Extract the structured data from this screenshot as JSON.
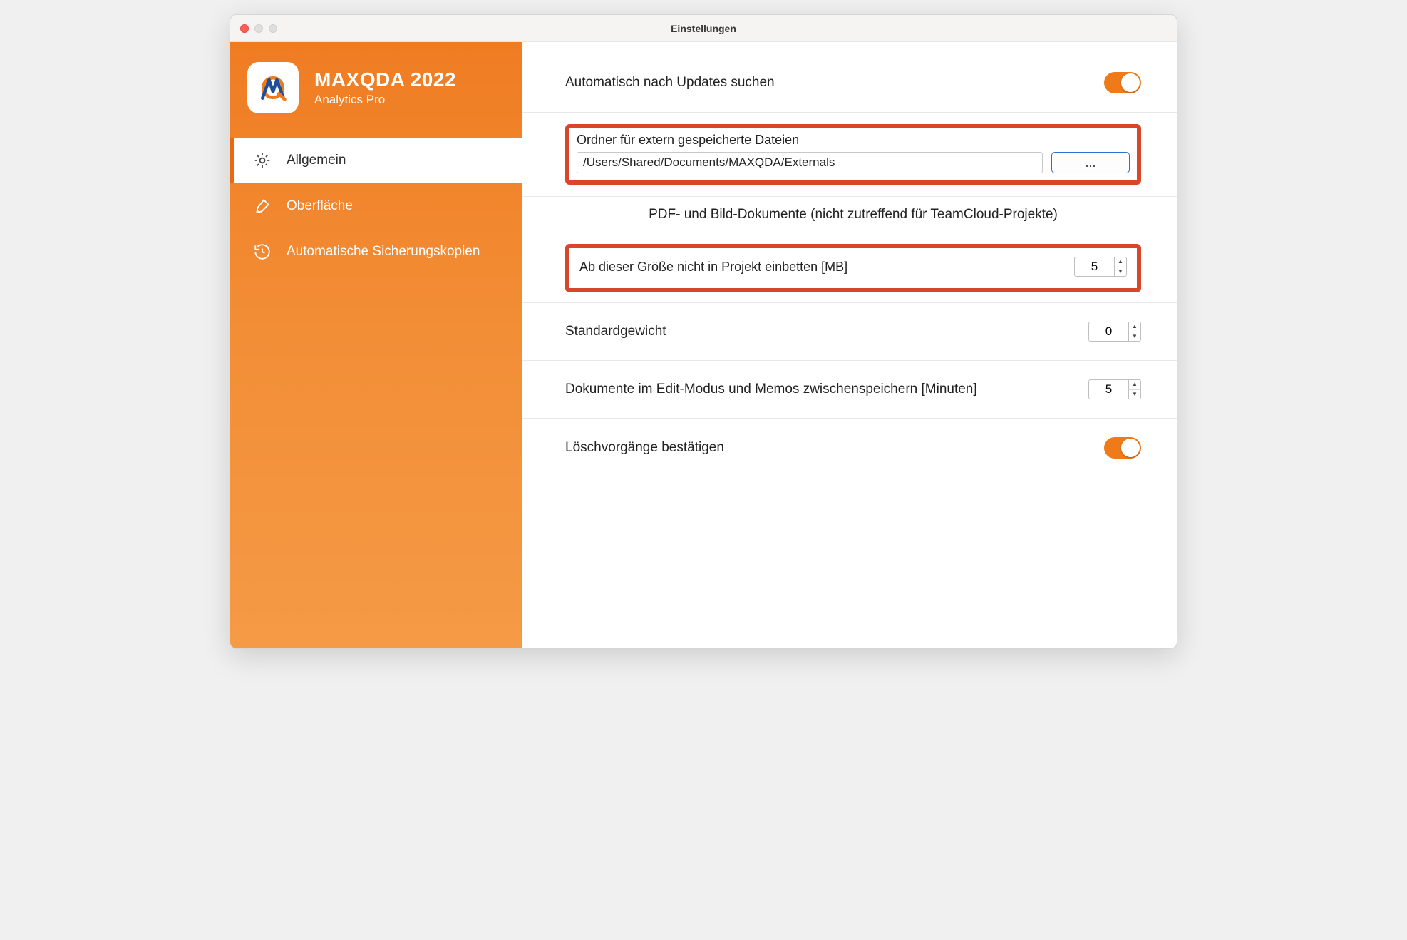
{
  "window": {
    "title": "Einstellungen"
  },
  "brand": {
    "name": "MAXQDA 2022",
    "subtitle": "Analytics Pro"
  },
  "sidebar": {
    "items": [
      {
        "label": "Allgemein"
      },
      {
        "label": "Oberfläche"
      },
      {
        "label": "Automatische Sicherungskopien"
      }
    ]
  },
  "settings": {
    "auto_update_label": "Automatisch nach Updates suchen",
    "auto_update_on": true,
    "ext_folder_label": "Ordner für extern gespeicherte Dateien",
    "ext_folder_path": "/Users/Shared/Documents/MAXQDA/Externals",
    "browse_label": "...",
    "pdf_section_title": "PDF- und Bild-Dokumente (nicht zutreffend für TeamCloud-Projekte)",
    "embed_threshold_label": "Ab dieser Größe nicht in Projekt einbetten [MB]",
    "embed_threshold_value": "5",
    "default_weight_label": "Standardgewicht",
    "default_weight_value": "0",
    "autosave_label": "Dokumente im Edit-Modus und Memos zwischenspeichern [Minuten]",
    "autosave_value": "5",
    "confirm_delete_label": "Löschvorgänge bestätigen",
    "confirm_delete_on": true
  }
}
